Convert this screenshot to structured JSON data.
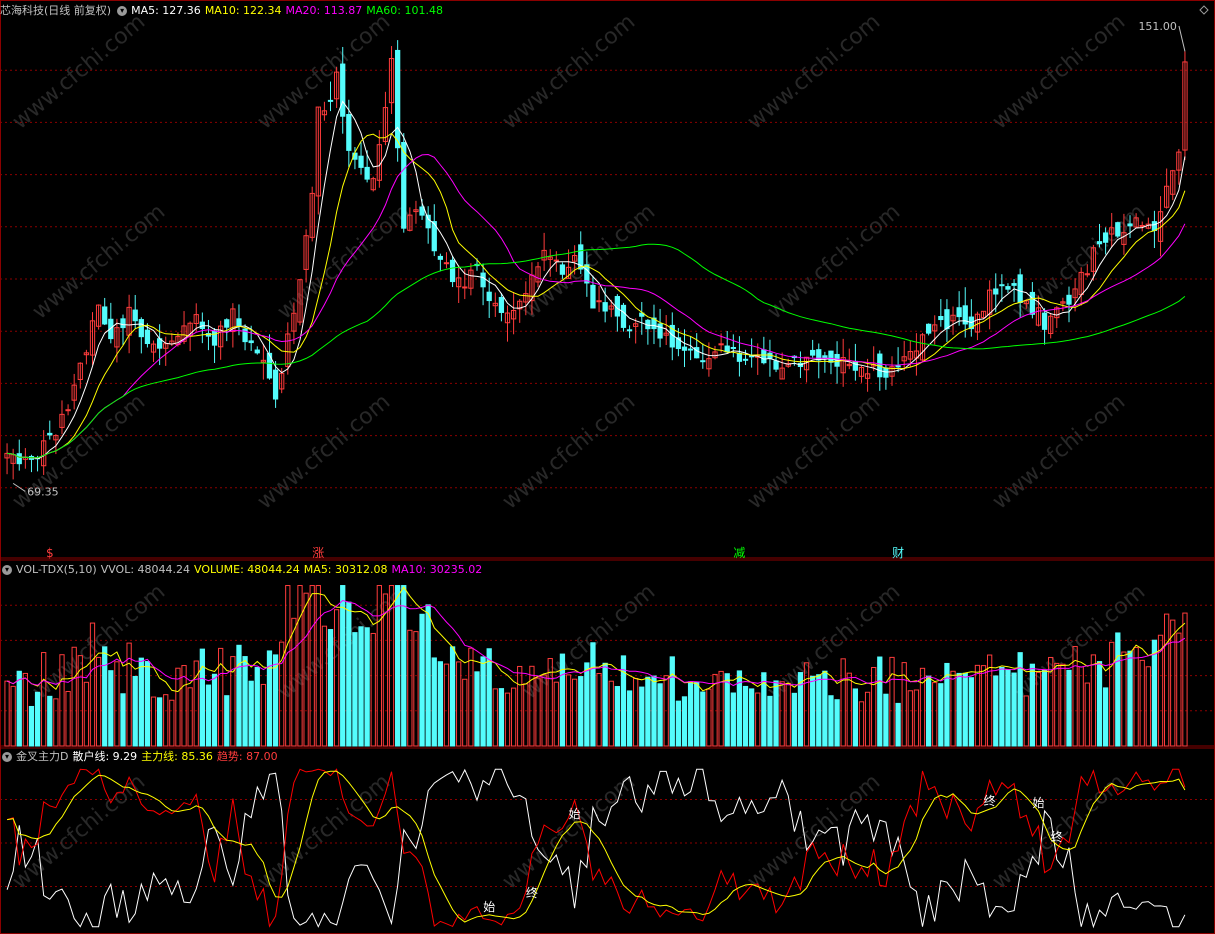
{
  "colors": {
    "background": "#000000",
    "grid": "#8b0000",
    "up": "#ff3c3c",
    "down": "#54fcfc",
    "ma5": "#ffffff",
    "ma10": "#ffff00",
    "ma20": "#ff00ff",
    "ma60": "#00ff00",
    "scatter": "#ffffff",
    "main": "#ffff00",
    "trend": "#ff0000",
    "watermark": "#4a4a4a"
  },
  "price_panel": {
    "title": "芯海科技(日线 前复权)",
    "ma5_label": "MA5: 127.36",
    "ma10_label": "MA10: 122.34",
    "ma20_label": "MA20: 113.87",
    "ma60_label": "MA60: 101.48",
    "high_label": "151.00",
    "low_label": "69.35",
    "markers": [
      {
        "text": "$",
        "color": "#ff3c3c",
        "day": 7
      },
      {
        "text": "涨",
        "color": "#ff3c3c",
        "day": 51
      },
      {
        "text": "减",
        "color": "#00ff00",
        "day": 120
      },
      {
        "text": "财",
        "color": "#54fcfc",
        "day": 146
      }
    ]
  },
  "volume_panel": {
    "title": "VOL-TDX(5,10)",
    "vvol_label": "VVOL: 48044.24",
    "volume_label": "VOLUME: 48044.24",
    "ma5_label": "MA5: 30312.08",
    "ma10_label": "MA10: 30235.02"
  },
  "indicator_panel": {
    "title": "金叉主力D",
    "scatter_label": "散户线: 9.29",
    "main_label": "主力线: 85.36",
    "trend_label": "趋势: 87.00",
    "annotations": [
      {
        "text": "始",
        "day": 79
      },
      {
        "text": "终",
        "day": 86
      },
      {
        "text": "始",
        "day": 93
      },
      {
        "text": "终",
        "day": 161
      },
      {
        "text": "始",
        "day": 169
      },
      {
        "text": "终",
        "day": 172
      }
    ]
  },
  "watermark": "www.cfchi.com",
  "chart_data": {
    "type": "candlestick",
    "title": "芯海科技(日线 前复权)",
    "price_range": [
      60,
      156
    ],
    "volume_range": [
      0,
      60000
    ],
    "indicator_range": [
      0,
      100
    ],
    "days": 194,
    "close_anchors": [
      [
        0,
        76
      ],
      [
        4,
        75
      ],
      [
        7,
        78
      ],
      [
        10,
        85
      ],
      [
        13,
        95
      ],
      [
        15,
        103
      ],
      [
        17,
        97
      ],
      [
        20,
        102
      ],
      [
        22,
        97
      ],
      [
        25,
        95
      ],
      [
        28,
        98
      ],
      [
        31,
        100
      ],
      [
        34,
        97
      ],
      [
        37,
        101
      ],
      [
        40,
        95
      ],
      [
        42,
        92
      ],
      [
        44,
        86
      ],
      [
        46,
        98
      ],
      [
        48,
        108
      ],
      [
        50,
        125
      ],
      [
        51,
        140
      ],
      [
        52,
        138
      ],
      [
        54,
        145
      ],
      [
        56,
        132
      ],
      [
        58,
        130
      ],
      [
        60,
        125
      ],
      [
        62,
        140
      ],
      [
        63,
        148
      ],
      [
        65,
        118
      ],
      [
        68,
        120
      ],
      [
        71,
        112
      ],
      [
        74,
        107
      ],
      [
        77,
        110
      ],
      [
        80,
        103
      ],
      [
        83,
        101
      ],
      [
        86,
        108
      ],
      [
        88,
        113
      ],
      [
        91,
        110
      ],
      [
        93,
        111
      ],
      [
        96,
        104
      ],
      [
        99,
        103
      ],
      [
        102,
        99
      ],
      [
        105,
        100
      ],
      [
        108,
        97
      ],
      [
        111,
        94
      ],
      [
        114,
        93
      ],
      [
        117,
        96
      ],
      [
        120,
        94
      ],
      [
        123,
        95
      ],
      [
        126,
        92
      ],
      [
        129,
        93
      ],
      [
        132,
        94
      ],
      [
        135,
        92
      ],
      [
        138,
        93
      ],
      [
        141,
        92
      ],
      [
        144,
        91
      ],
      [
        146,
        91
      ],
      [
        149,
        95
      ],
      [
        152,
        99
      ],
      [
        155,
        100
      ],
      [
        158,
        99
      ],
      [
        161,
        105
      ],
      [
        164,
        107
      ],
      [
        167,
        104
      ],
      [
        170,
        100
      ],
      [
        173,
        103
      ],
      [
        176,
        108
      ],
      [
        179,
        115
      ],
      [
        182,
        117
      ],
      [
        185,
        119
      ],
      [
        188,
        118
      ],
      [
        190,
        125
      ],
      [
        192,
        132
      ],
      [
        193,
        148
      ]
    ],
    "ma_periods": [
      5,
      10,
      20,
      60
    ]
  }
}
